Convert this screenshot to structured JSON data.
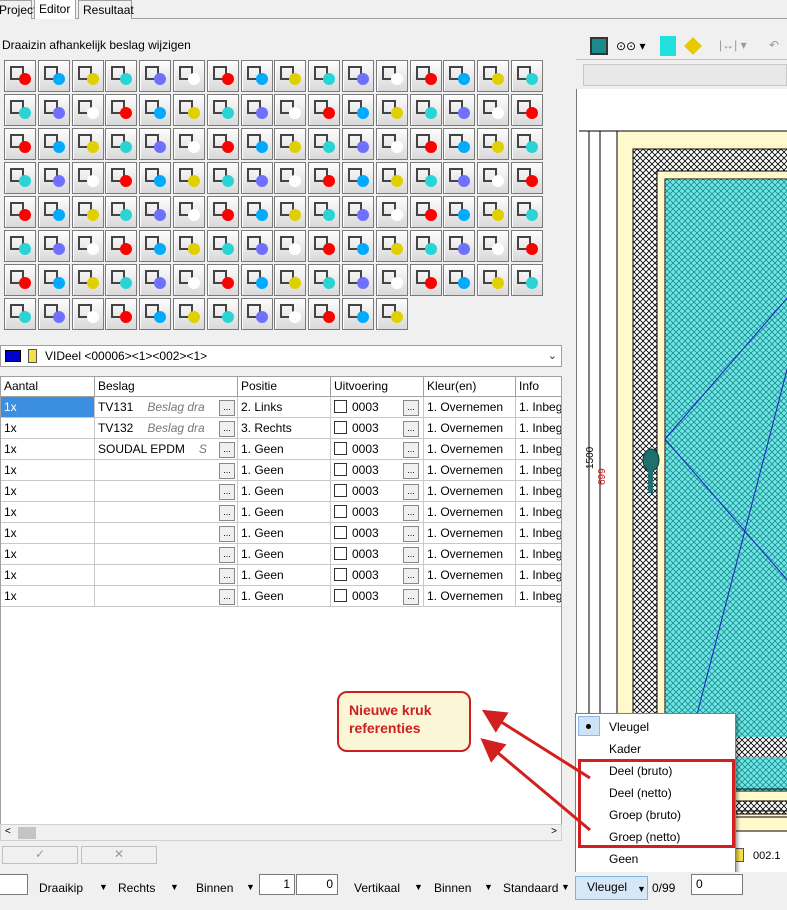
{
  "tabs": {
    "project": "Project",
    "editor": "Editor",
    "resultaat": "Resultaat"
  },
  "panel_title": "Draaizin afhankelijk beslag wijzigen",
  "part_selector": {
    "value": "VIDeel <00006><1><002><1>"
  },
  "table": {
    "headers": [
      "Aantal",
      "Beslag",
      "Positie",
      "Uitvoering",
      "Kleur(en)",
      "Info"
    ],
    "rows": [
      {
        "aantal": "1x",
        "beslag": "TV131",
        "beslag_sub": "Beslag dra",
        "positie": "2. Links",
        "uitvoering": "0003",
        "kleur": "1. Overnemen",
        "info": "1. Inbeg"
      },
      {
        "aantal": "1x",
        "beslag": "TV132",
        "beslag_sub": "Beslag dra",
        "positie": "3. Rechts",
        "uitvoering": "0003",
        "kleur": "1. Overnemen",
        "info": "1. Inbeg"
      },
      {
        "aantal": "1x",
        "beslag": "SOUDAL EPDM",
        "beslag_sub": "S",
        "positie": "1. Geen",
        "uitvoering": "0003",
        "kleur": "1. Overnemen",
        "info": "1. Inbeg"
      },
      {
        "aantal": "1x",
        "beslag": "",
        "beslag_sub": "",
        "positie": "1. Geen",
        "uitvoering": "0003",
        "kleur": "1. Overnemen",
        "info": "1. Inbeg"
      },
      {
        "aantal": "1x",
        "beslag": "",
        "beslag_sub": "",
        "positie": "1. Geen",
        "uitvoering": "0003",
        "kleur": "1. Overnemen",
        "info": "1. Inbeg"
      },
      {
        "aantal": "1x",
        "beslag": "",
        "beslag_sub": "",
        "positie": "1. Geen",
        "uitvoering": "0003",
        "kleur": "1. Overnemen",
        "info": "1. Inbeg"
      },
      {
        "aantal": "1x",
        "beslag": "",
        "beslag_sub": "",
        "positie": "1. Geen",
        "uitvoering": "0003",
        "kleur": "1. Overnemen",
        "info": "1. Inbeg"
      },
      {
        "aantal": "1x",
        "beslag": "",
        "beslag_sub": "",
        "positie": "1. Geen",
        "uitvoering": "0003",
        "kleur": "1. Overnemen",
        "info": "1. Inbeg"
      },
      {
        "aantal": "1x",
        "beslag": "",
        "beslag_sub": "",
        "positie": "1. Geen",
        "uitvoering": "0003",
        "kleur": "1. Overnemen",
        "info": "1. Inbeg"
      },
      {
        "aantal": "1x",
        "beslag": "",
        "beslag_sub": "",
        "positie": "1. Geen",
        "uitvoering": "0003",
        "kleur": "1. Overnemen",
        "info": "1. Inbeg"
      }
    ]
  },
  "buttons": {
    "ok": "✓",
    "cancel": "✕"
  },
  "bottombar": {
    "draaikip": "Draaikip",
    "rechts": "Rechts",
    "binnen1": "Binnen",
    "num1": "1",
    "num2": "0",
    "vertikaal": "Vertikaal",
    "binnen2": "Binnen",
    "standaard": "Standaard",
    "vleugel": "Vleugel",
    "count": "0/99",
    "num3": "0"
  },
  "context_menu": {
    "items": [
      "Vleugel",
      "Kader",
      "Deel (bruto)",
      "Deel (netto)",
      "Groep (bruto)",
      "Groep (netto)",
      "Geen"
    ],
    "checked": "Vleugel"
  },
  "callout": {
    "line1": "Nieuwe kruk",
    "line2": "referenties"
  },
  "drawing": {
    "dim_outer": "1500",
    "dim_inner": "699",
    "label": "002.1"
  },
  "colors": {
    "accent_red": "#cc2020",
    "glass": "#2ad4d4",
    "selection": "#3c8fe0"
  }
}
